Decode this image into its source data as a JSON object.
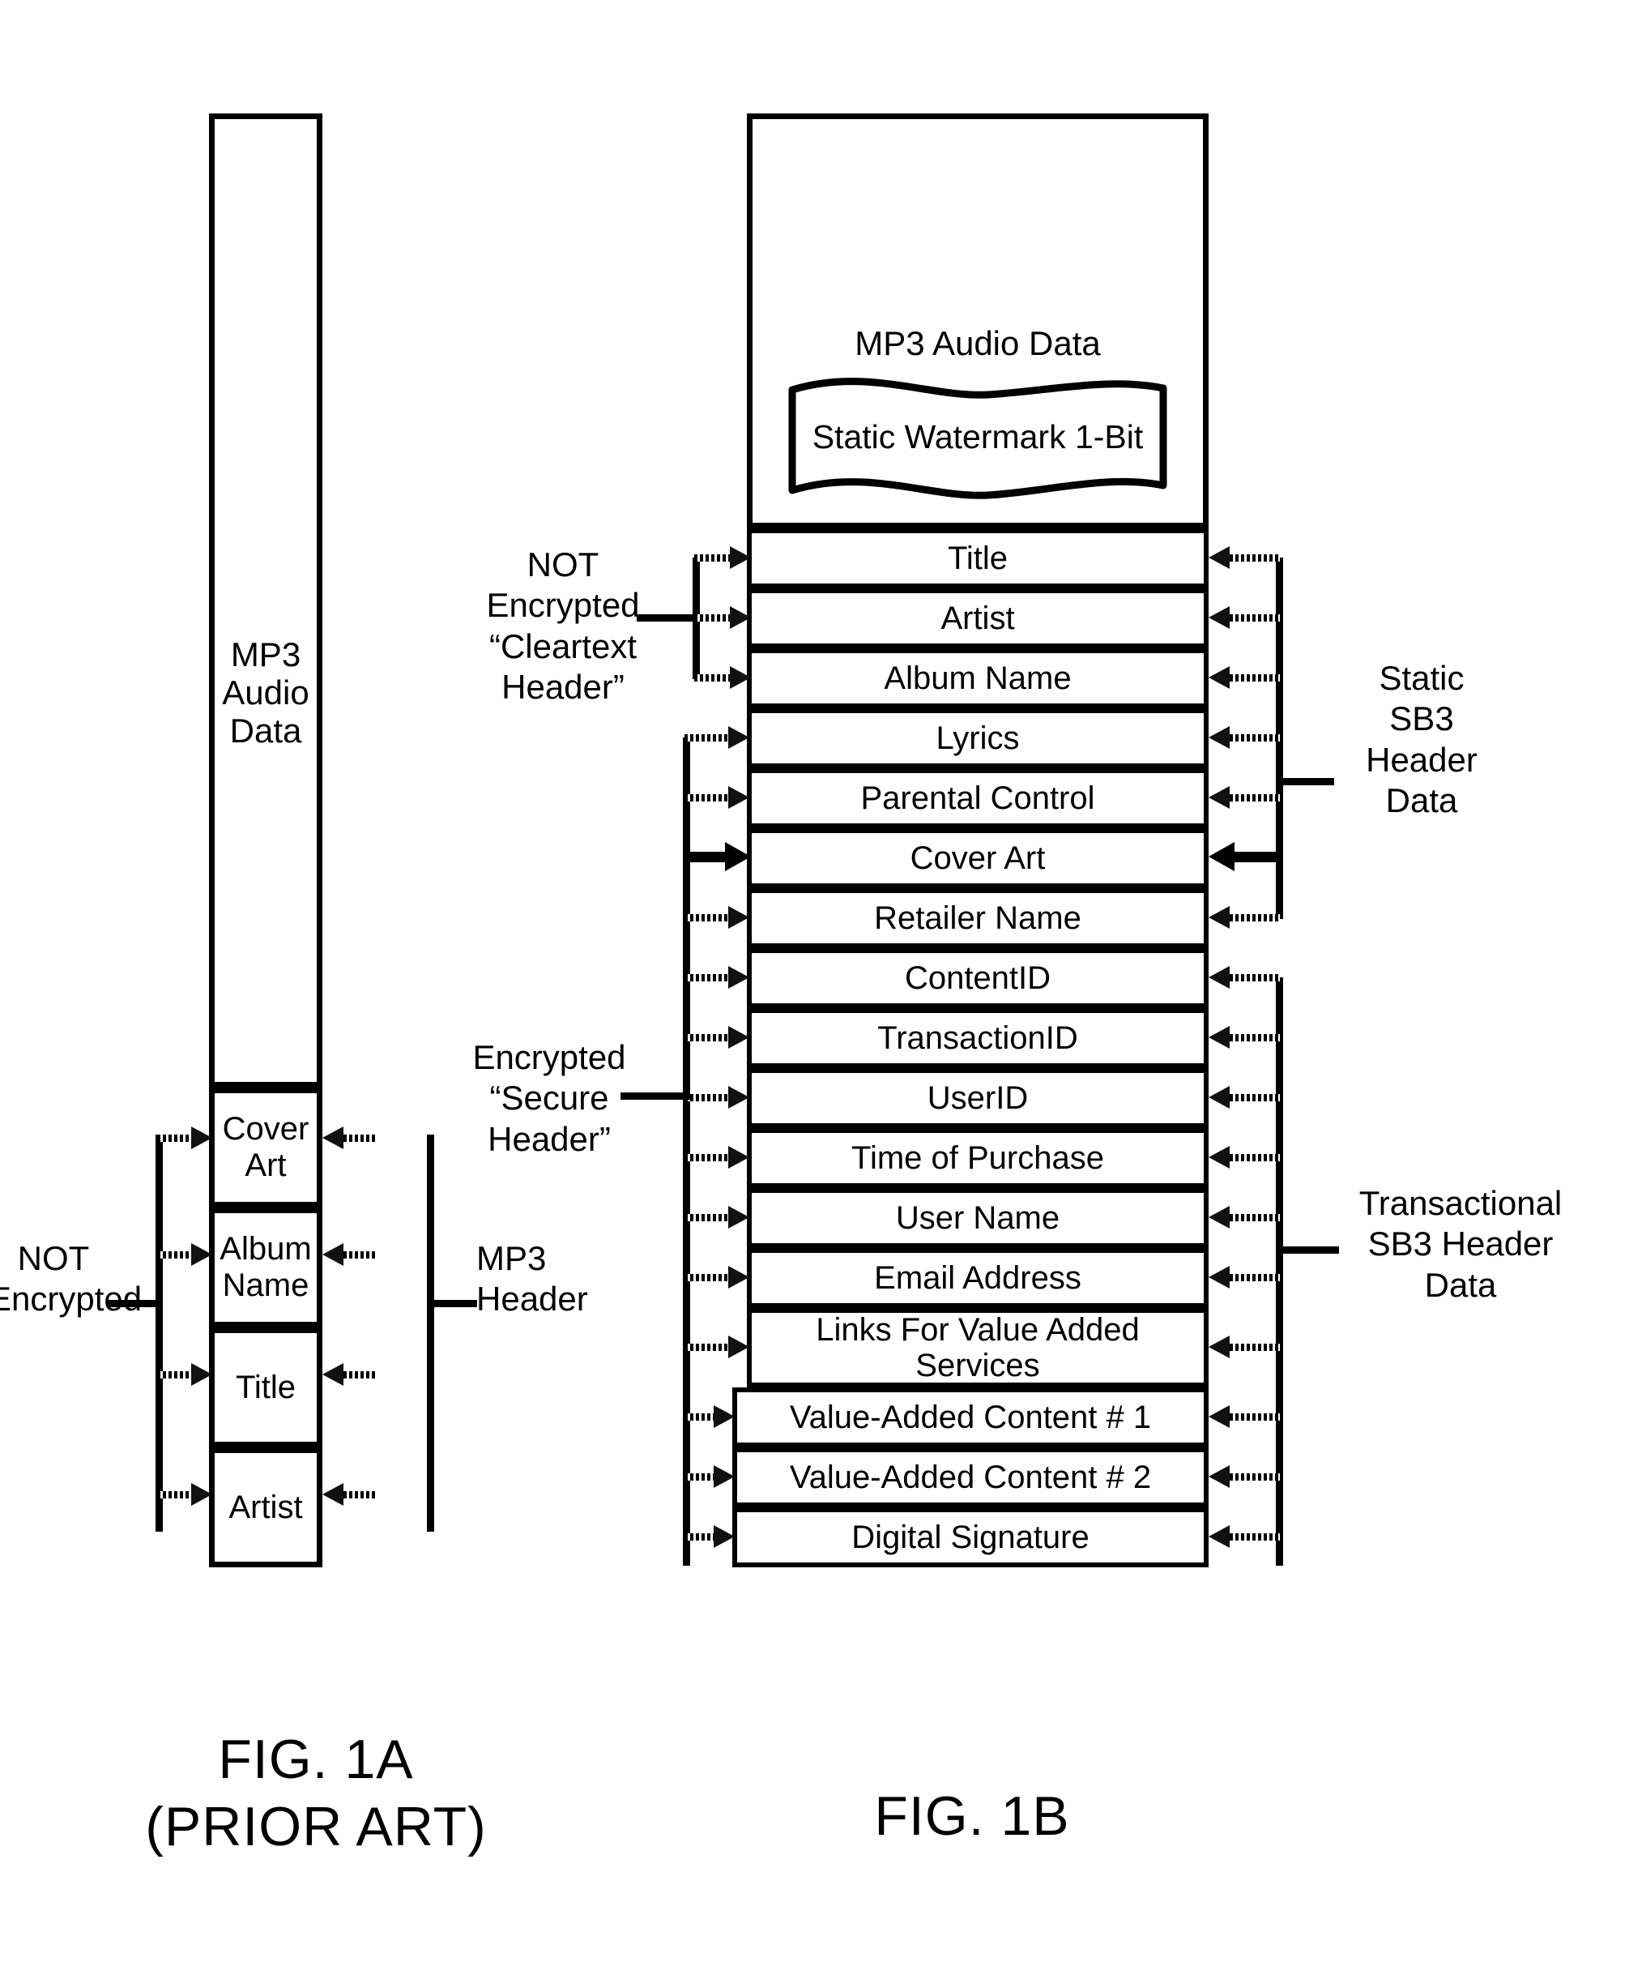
{
  "figure_a": {
    "caption": "FIG. 1A\n(PRIOR ART)",
    "audio_block": "MP3\nAudio\nData",
    "header_rows": [
      {
        "label": "Cover\nArt"
      },
      {
        "label": "Album\nName"
      },
      {
        "label": "Title"
      },
      {
        "label": "Artist"
      }
    ],
    "left_label": "NOT\nEncrypted",
    "right_label": "MP3\nHeader"
  },
  "figure_b": {
    "caption": "FIG. 1B",
    "audio_block": {
      "title": "MP3 Audio Data",
      "watermark": "Static Watermark 1-Bit"
    },
    "header_rows": [
      {
        "label": "Title",
        "group_left": "cleartext",
        "group_right": "static"
      },
      {
        "label": "Artist",
        "group_left": "cleartext",
        "group_right": "static"
      },
      {
        "label": "Album Name",
        "group_left": "cleartext",
        "group_right": "static"
      },
      {
        "label": "Lyrics",
        "group_left": "secure",
        "group_right": "static"
      },
      {
        "label": "Parental Control",
        "group_left": "secure",
        "group_right": "static"
      },
      {
        "label": "Cover Art",
        "group_left": "secure",
        "group_right": "static"
      },
      {
        "label": "Retailer Name",
        "group_left": "secure",
        "group_right": "static"
      },
      {
        "label": "ContentID",
        "group_left": "secure",
        "group_right": "transactional"
      },
      {
        "label": "TransactionID",
        "group_left": "secure",
        "group_right": "transactional"
      },
      {
        "label": "UserID",
        "group_left": "secure",
        "group_right": "transactional"
      },
      {
        "label": "Time of Purchase",
        "group_left": "secure",
        "group_right": "transactional"
      },
      {
        "label": "User Name",
        "group_left": "secure",
        "group_right": "transactional"
      },
      {
        "label": "Email Address",
        "group_left": "secure",
        "group_right": "transactional"
      },
      {
        "label": "Links For Value Added Services",
        "group_left": "secure",
        "group_right": "transactional"
      },
      {
        "label": "Value-Added Content # 1",
        "group_left": "secure",
        "group_right": "transactional"
      },
      {
        "label": "Value-Added Content # 2",
        "group_left": "secure",
        "group_right": "transactional"
      },
      {
        "label": "Digital Signature",
        "group_left": "secure",
        "group_right": "transactional"
      }
    ],
    "left_label_cleartext": "NOT\nEncrypted\n“Cleartext\nHeader”",
    "left_label_secure": "Encrypted\n“Secure\nHeader”",
    "right_label_static": "Static\nSB3\nHeader\nData",
    "right_label_transactional": "Transactional\nSB3 Header\nData"
  },
  "colors": {
    "ink": "#000000",
    "paper": "#ffffff"
  }
}
